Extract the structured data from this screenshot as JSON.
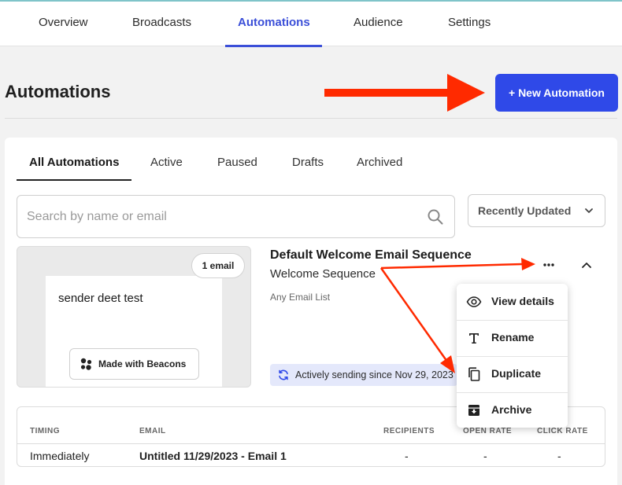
{
  "topnav": {
    "tabs": [
      {
        "label": "Overview"
      },
      {
        "label": "Broadcasts"
      },
      {
        "label": "Automations",
        "active": true
      },
      {
        "label": "Audience"
      },
      {
        "label": "Settings"
      }
    ]
  },
  "page": {
    "title": "Automations",
    "new_button": "+ New Automation"
  },
  "subtabs": [
    {
      "label": "All Automations",
      "active": true
    },
    {
      "label": "Active"
    },
    {
      "label": "Paused"
    },
    {
      "label": "Drafts"
    },
    {
      "label": "Archived"
    }
  ],
  "search": {
    "placeholder": "Search by name or email",
    "value": ""
  },
  "sort": {
    "selected": "Recently Updated"
  },
  "automation": {
    "preview": {
      "email_count": "1 email",
      "sender": "sender deet test",
      "made_with": "Made with Beacons"
    },
    "title": "Default Welcome Email Sequence",
    "subtitle": "Welcome Sequence",
    "list": "Any Email List",
    "status": "Actively sending since Nov 29, 2023"
  },
  "menu": {
    "items": [
      {
        "label": "View details",
        "icon": "eye-icon"
      },
      {
        "label": "Rename",
        "icon": "text-icon"
      },
      {
        "label": "Duplicate",
        "icon": "copy-icon"
      },
      {
        "label": "Archive",
        "icon": "archive-icon"
      }
    ]
  },
  "table": {
    "headers": [
      "TIMING",
      "EMAIL",
      "RECIPIENTS",
      "OPEN RATE",
      "CLICK RATE"
    ],
    "rows": [
      [
        "Immediately",
        "Untitled 11/29/2023 - Email 1",
        "-",
        "-",
        "-"
      ]
    ]
  },
  "colors": {
    "accent": "#2f49e8",
    "active_tab": "#3b4fd8",
    "annotation_arrow": "#ff2a00",
    "status_chip_bg": "#e4e8fb"
  }
}
